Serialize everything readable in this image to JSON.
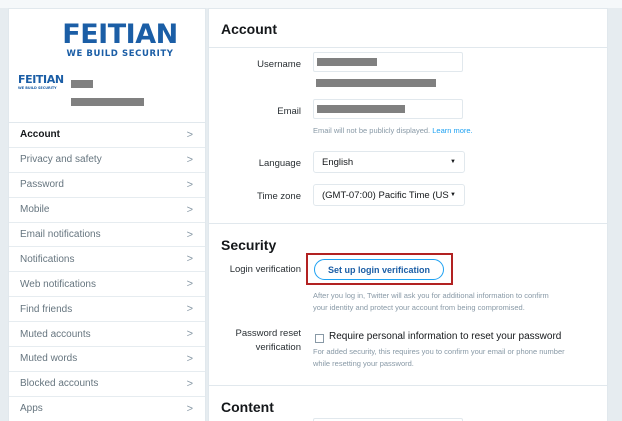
{
  "logo": {
    "brand": "FEITIAN",
    "tagline": "WE BUILD SECURITY"
  },
  "sidebar": {
    "items": [
      {
        "label": "Account",
        "chevron": ">"
      },
      {
        "label": "Privacy and safety",
        "chevron": ">"
      },
      {
        "label": "Password",
        "chevron": ">"
      },
      {
        "label": "Mobile",
        "chevron": ">"
      },
      {
        "label": "Email notifications",
        "chevron": ">"
      },
      {
        "label": "Notifications",
        "chevron": ">"
      },
      {
        "label": "Web notifications",
        "chevron": ">"
      },
      {
        "label": "Find friends",
        "chevron": ">"
      },
      {
        "label": "Muted accounts",
        "chevron": ">"
      },
      {
        "label": "Muted words",
        "chevron": ">"
      },
      {
        "label": "Blocked accounts",
        "chevron": ">"
      },
      {
        "label": "Apps",
        "chevron": ">"
      }
    ]
  },
  "account": {
    "title": "Account",
    "username_label": "Username",
    "email_label": "Email",
    "email_hint": "Email will not be publicly displayed.",
    "email_hint_link": "Learn more.",
    "language_label": "Language",
    "language_value": "English",
    "timezone_label": "Time zone",
    "timezone_value": "(GMT-07:00) Pacific Time (US"
  },
  "security": {
    "title": "Security",
    "login_verification_label": "Login verification",
    "login_verification_button": "Set up login verification",
    "login_verification_hint_1": "After you log in, Twitter will ask you for additional information to confirm",
    "login_verification_hint_2": "your identity and protect your account from being compromised.",
    "password_reset_label_1": "Password reset",
    "password_reset_label_2": "verification",
    "password_reset_checkbox": "Require personal information to reset your password",
    "password_reset_hint_1": "For added security, this requires you to confirm your email or phone number",
    "password_reset_hint_2": "while resetting your password."
  },
  "content": {
    "title": "Content"
  },
  "colors": {
    "accent": "#1da1f2",
    "brand": "#1b5ea6",
    "highlight_box": "#b22222",
    "redaction": "#808080"
  }
}
